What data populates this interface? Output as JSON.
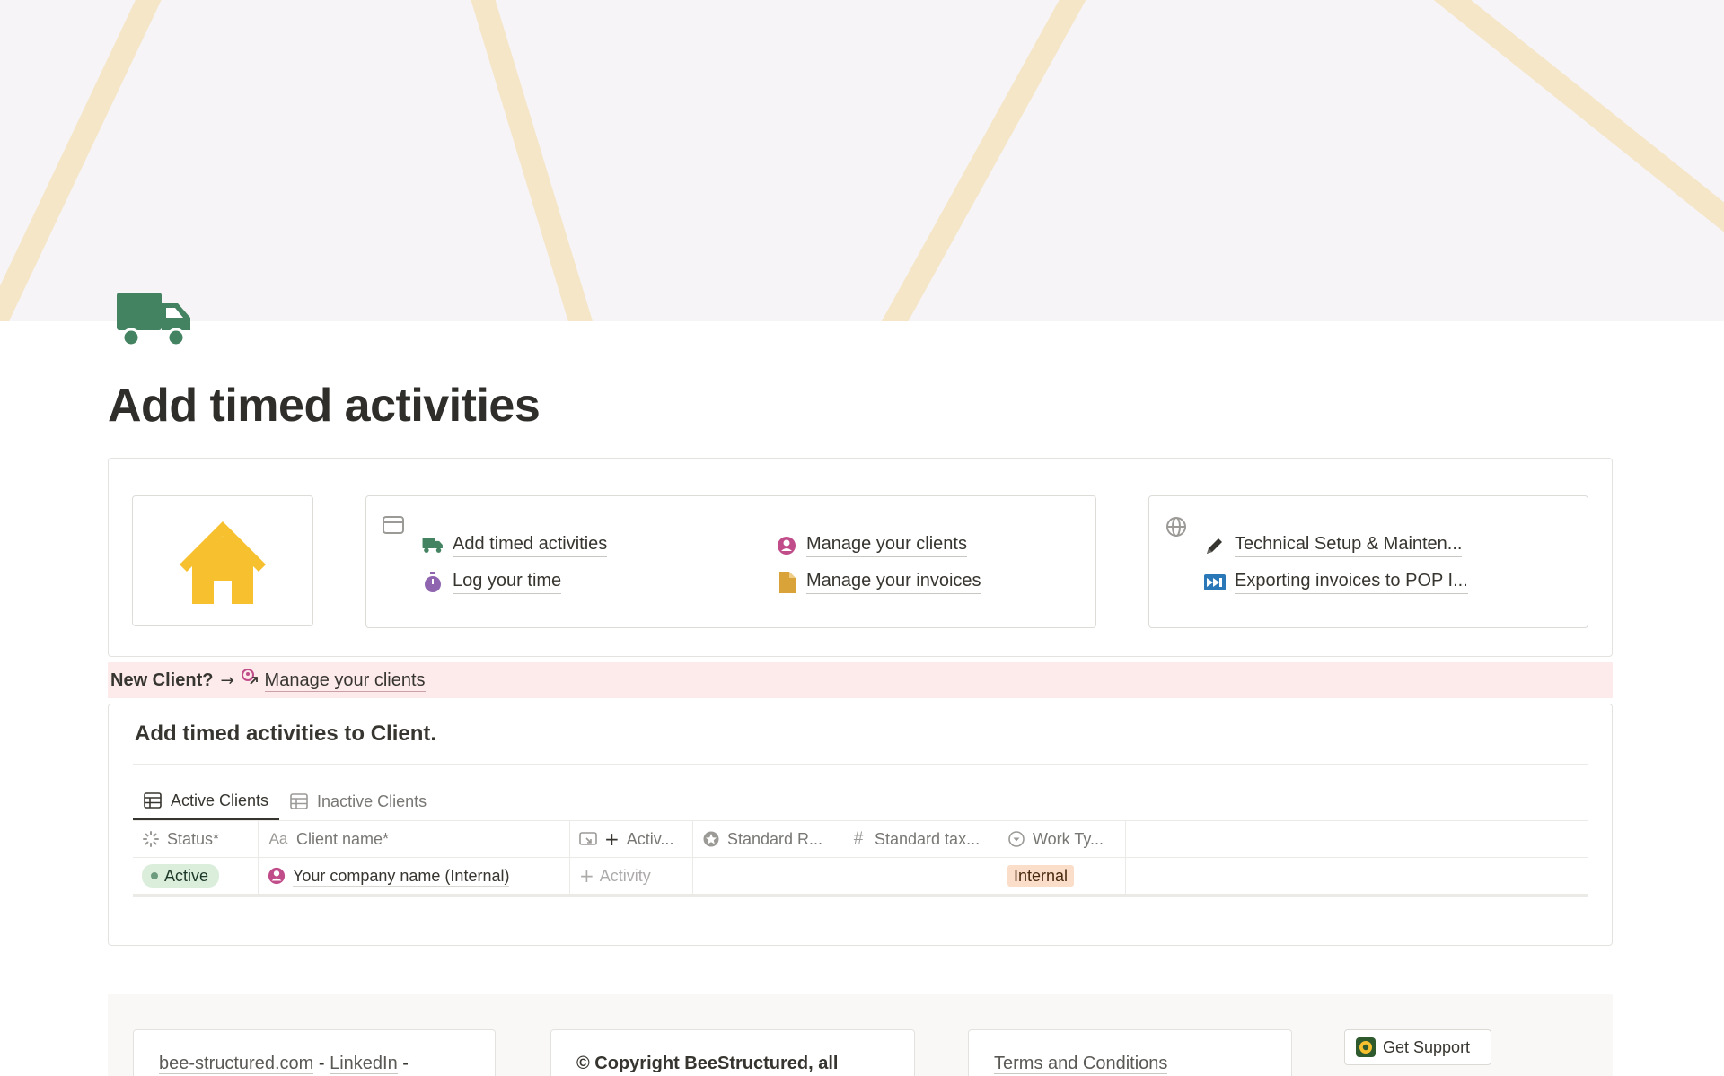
{
  "page": {
    "title": "Add timed activities"
  },
  "nav": {
    "links": [
      {
        "label": "Add timed activities",
        "icon": "truck-icon"
      },
      {
        "label": "Log your time",
        "icon": "stopwatch-icon"
      },
      {
        "label": "Manage your clients",
        "icon": "user-circle-icon"
      },
      {
        "label": "Manage your invoices",
        "icon": "document-icon"
      }
    ],
    "external": [
      {
        "label": "Technical Setup & Mainten...",
        "icon": "pencil-icon"
      },
      {
        "label": "Exporting invoices to POP I...",
        "icon": "fast-forward-icon"
      }
    ]
  },
  "callout": {
    "prefix": "New Client?",
    "arrow": "→",
    "link_label": "Manage your clients"
  },
  "database": {
    "title": "Add timed activities to Client.",
    "tabs": [
      {
        "label": "Active Clients",
        "active": true
      },
      {
        "label": "Inactive Clients",
        "active": false
      }
    ],
    "columns": [
      {
        "label": "Status*",
        "icon": "status-icon"
      },
      {
        "label": "Client name*",
        "icon": "text-aa-icon"
      },
      {
        "label": "Activ...",
        "icon": "relation-icon"
      },
      {
        "label": "Standard R...",
        "icon": "rollup-icon"
      },
      {
        "label": "Standard tax...",
        "icon": "hash-icon"
      },
      {
        "label": "Work Ty...",
        "icon": "select-icon"
      }
    ],
    "row": {
      "status": "Active",
      "client_name": "Your company name (Internal)",
      "add_activity": "Activity",
      "work_type": "Internal"
    }
  },
  "footer": {
    "site_link": "bee-structured.com",
    "separator": "-",
    "linkedin_link": "LinkedIn",
    "trailing_dash": "-",
    "copyright": "© Copyright BeeStructured, all",
    "terms": "Terms and Conditions",
    "support_label": "Get Support"
  },
  "colors": {
    "cover_background": "#f6f4f6",
    "cover_stripes": "#f5e6c8",
    "truck_green": "#448361",
    "home_yellow": "#f7c02f",
    "callout_pink": "#fdebec",
    "status_green": "#dbeddb",
    "internal_tag": "#fadec9"
  }
}
